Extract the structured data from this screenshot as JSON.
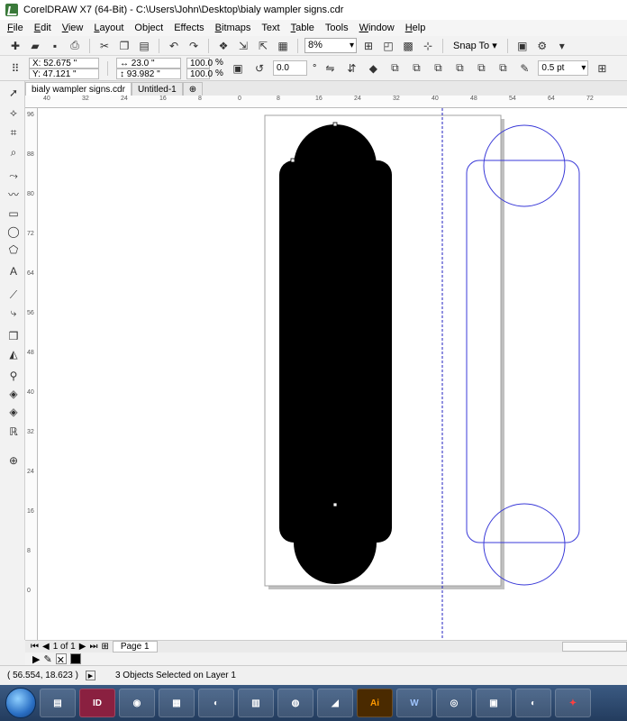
{
  "window": {
    "title": "CorelDRAW X7 (64-Bit) - C:\\Users\\John\\Desktop\\bialy wampler signs.cdr"
  },
  "menu": [
    {
      "mn": "F",
      "rest": "ile"
    },
    {
      "mn": "E",
      "rest": "dit"
    },
    {
      "mn": "V",
      "rest": "iew"
    },
    {
      "mn": "L",
      "rest": "ayout"
    },
    {
      "mn": "",
      "rest": "Object"
    },
    {
      "mn": "",
      "rest": "Effects"
    },
    {
      "mn": "B",
      "rest": "itmaps"
    },
    {
      "mn": "",
      "rest": "Text"
    },
    {
      "mn": "T",
      "rest": "able"
    },
    {
      "mn": "",
      "rest": "Tools"
    },
    {
      "mn": "W",
      "rest": "indow"
    },
    {
      "mn": "H",
      "rest": "elp"
    }
  ],
  "toolbar": {
    "zoom": "8%",
    "snap_label": "Snap To"
  },
  "properties": {
    "x": "X: 52.675 \"",
    "y": "Y: 47.121 \"",
    "width": "23.0 \"",
    "height": "93.982 \"",
    "scale_x": "100.0",
    "scale_y": "100.0",
    "pct": "%",
    "rotation": "0.0",
    "degree": "°",
    "outline_width": "0.5 pt"
  },
  "tabs": [
    {
      "label": "bialy wampler signs.cdr",
      "active": true
    },
    {
      "label": "Untitled-1",
      "active": false
    }
  ],
  "ruler_h": [
    "40",
    "32",
    "24",
    "16",
    "8",
    "0",
    "8",
    "16",
    "24",
    "32",
    "40",
    "48",
    "54",
    "64",
    "72"
  ],
  "ruler_v": [
    "96",
    "88",
    "80",
    "72",
    "64",
    "56",
    "48",
    "40",
    "32",
    "24",
    "16",
    "8",
    "0"
  ],
  "pagebar": {
    "page_count": "1 of 1",
    "page_tab": "Page 1"
  },
  "status": {
    "coords": "( 56.554, 18.623 )",
    "message": "3 Objects Selected on Layer 1"
  },
  "colors": {
    "shape_fill": "#000000",
    "outline": "#3a3ad8",
    "guide": "#2020c0"
  },
  "taskbar": {
    "apps": [
      "explorer",
      "ID",
      "chrome",
      "calculator",
      "app",
      "archive",
      "logo",
      "app",
      "Ai",
      "W",
      "webcam",
      "doc",
      "app",
      "pdf"
    ]
  }
}
